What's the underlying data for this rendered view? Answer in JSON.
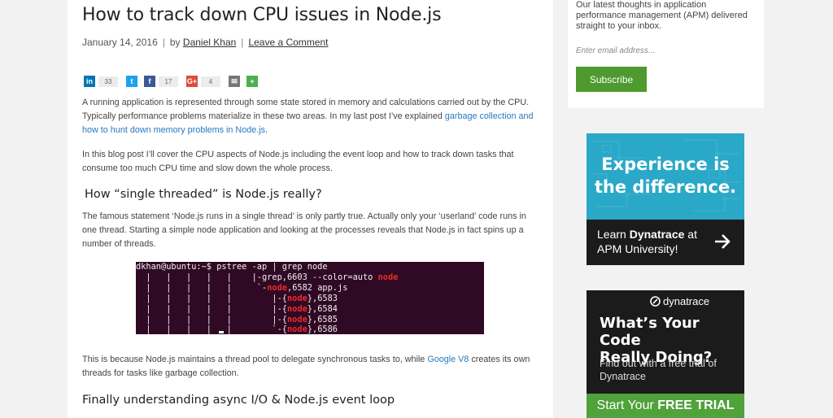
{
  "article": {
    "title": "How to track down CPU issues in Node.js",
    "date": "January 14, 2016",
    "by": "by",
    "author": "Daniel Khan",
    "comment_link": "Leave a Comment",
    "share": [
      {
        "icon": "linkedin-icon",
        "glyph": "in",
        "color": "#0077b5",
        "count": "33"
      },
      {
        "icon": "twitter-icon",
        "glyph": "t",
        "color": "#1da1f2",
        "count": ""
      },
      {
        "icon": "facebook-icon",
        "glyph": "f",
        "color": "#3b5998",
        "count": "17"
      },
      {
        "icon": "googleplus-icon",
        "glyph": "G+",
        "color": "#dd4b39",
        "count": "4"
      },
      {
        "icon": "email-icon",
        "glyph": "✉",
        "color": "#777777",
        "count": ""
      },
      {
        "icon": "more-share-icon",
        "glyph": "+",
        "color": "#4caf50",
        "count": ""
      }
    ],
    "p1_pre": "A running application is represented through some state stored in memory and calculations carried out by the CPU. Typically performance problems materialize in these two areas. In my last post I’ve explained ",
    "p1_link": "garbage collection and how to hunt down memory problems in Node.js",
    "p1_post": ".",
    "p2": "In this blog post I’ll cover the CPU aspects of Node.js including the event loop and how to track down tasks that consume too much CPU time and slow down the whole process.",
    "h2_1": "How “single threaded” is Node.js really?",
    "p3": "The famous statement ‘Node.js runs in a single thread’ is only partly true. Actually only your ‘userland’ code runs in one thread. Starting a simple node application and looking at the processes reveals that Node.js in fact spins up a number of threads.",
    "p4_pre": "This is because Node.js maintains a thread pool to delegate synchronous tasks to, while ",
    "p4_link": "Google V8",
    "p4_post": " creates its own threads for tasks like garbage collection.",
    "h2_2": "Finally understanding async I/O & Node.js event loop"
  },
  "terminal": {
    "prompt": "dkhan@ubuntu:~$ pstree -ap | grep node",
    "l2_pre": "  |   |   |   |   |    |-grep,6603 --color=auto ",
    "l2_hl": "node",
    "l3_pre": "  |   |   |   |   |     `-",
    "l3_hl": "node",
    "l3_post": ",6582 app.js",
    "tpre": "  |   |   |   |   |        |-{",
    "tpre_last": "  |   |   |   |   |        `-{",
    "hl": "node",
    "t1": "},6583",
    "t2": "},6584",
    "t3": "},6585",
    "t4": "},6586"
  },
  "sidebar": {
    "newsletter_text": "Our latest thoughts in application performance management (APM) delivered straight to your inbox.",
    "email_placeholder": "Enter email address...",
    "subscribe_label": "Subscribe"
  },
  "ad1": {
    "headline_1": "Experience is",
    "headline_2": "the difference.",
    "learn": "Learn ",
    "brand": "Dynatrace",
    "at": " at",
    "university": "APM University!"
  },
  "ad2": {
    "logo": "dynatrace",
    "headline_1": "What’s Your Code",
    "headline_2": "Really Doing?",
    "sub": "Find out with a free trial of Dynatrace",
    "cta_pre": "Start Your ",
    "cta_bold": "FREE TRIAL"
  }
}
